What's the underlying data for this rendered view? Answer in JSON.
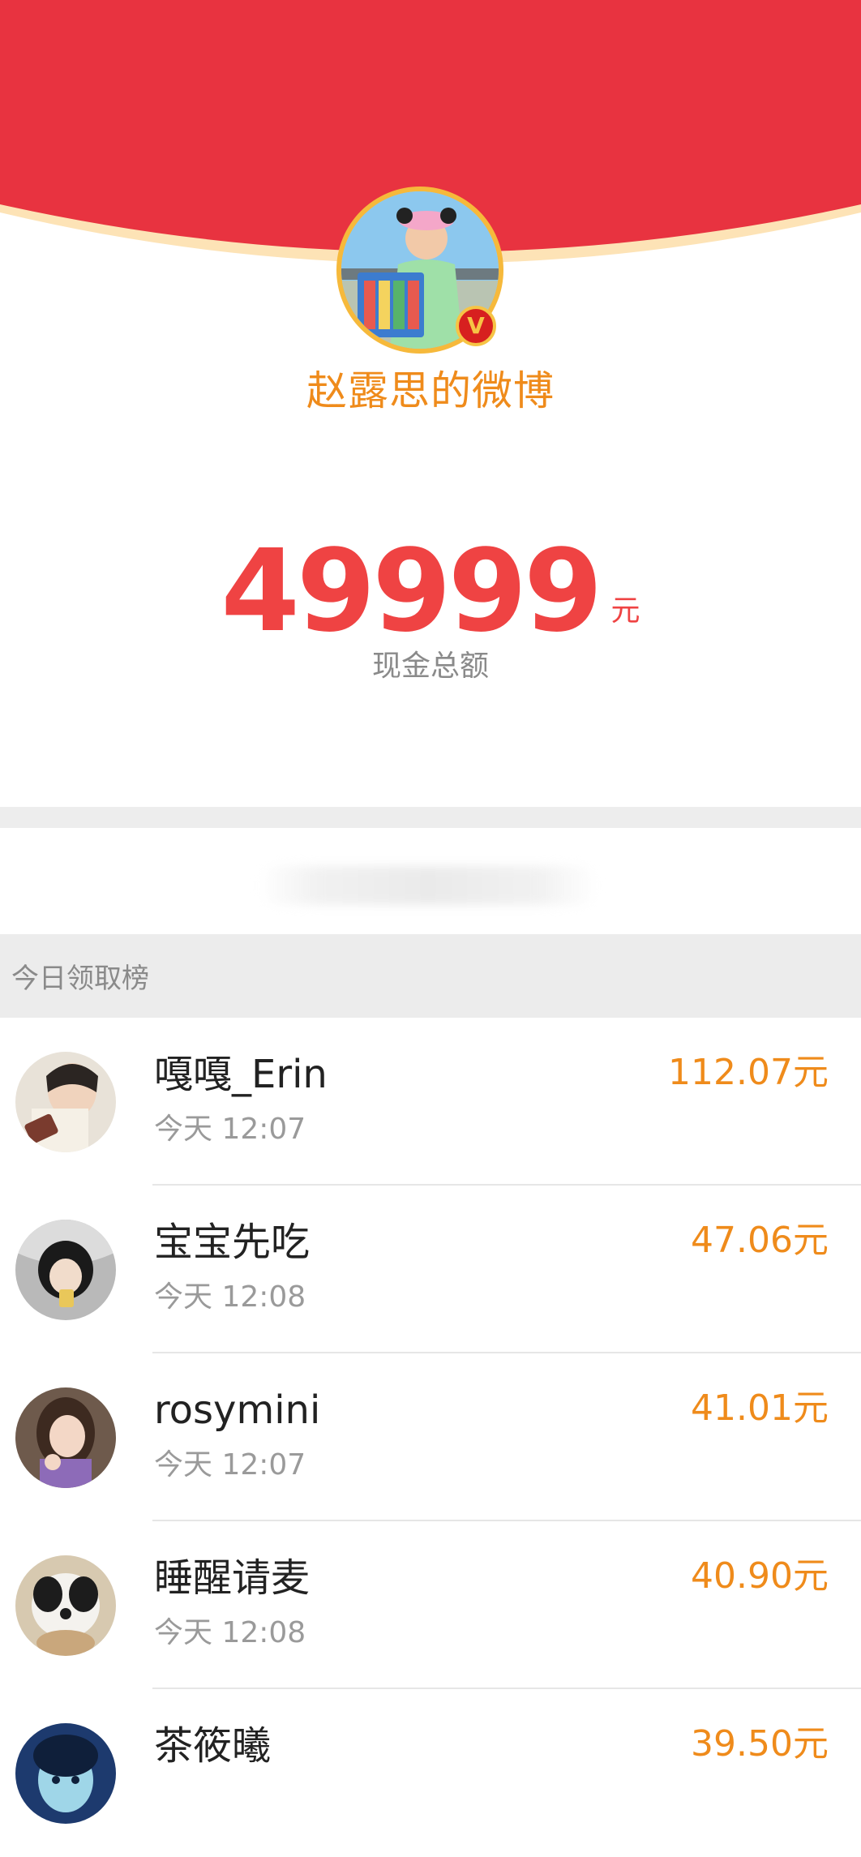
{
  "header": {
    "account_name": "赵露思的微博",
    "verified_badge": "V"
  },
  "total": {
    "amount": "49999",
    "unit": "元",
    "label": "现金总额"
  },
  "leaderboard": {
    "title": "今日领取榜",
    "entries": [
      {
        "name": "嘎嘎_Erin",
        "time": "今天 12:07",
        "amount": "112.07元"
      },
      {
        "name": "宝宝先吃",
        "time": "今天 12:08",
        "amount": "47.06元"
      },
      {
        "name": "rosymini",
        "time": "今天 12:07",
        "amount": "41.01元"
      },
      {
        "name": "睡醒请麦",
        "time": "今天 12:08",
        "amount": "40.90元"
      },
      {
        "name": "茶筱曦",
        "time": "",
        "amount": "39.50元"
      }
    ]
  },
  "colors": {
    "header_red": "#e83340",
    "accent_orange": "#ef8b1b",
    "amount_red": "#ef4343"
  }
}
